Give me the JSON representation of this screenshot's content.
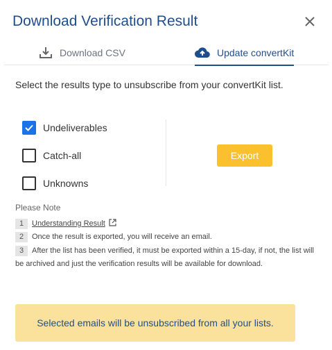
{
  "dialog": {
    "title": "Download Verification Result"
  },
  "tabs": [
    {
      "label": "Download CSV",
      "icon": "download-icon",
      "active": false
    },
    {
      "label": "Update convertKit",
      "icon": "cloud-upload-icon",
      "active": true
    }
  ],
  "instruction": "Select the results type to unsubscribe from your convertKit list.",
  "options": [
    {
      "label": "Undeliverables",
      "checked": true
    },
    {
      "label": "Catch-all",
      "checked": false
    },
    {
      "label": "Unknowns",
      "checked": false
    }
  ],
  "export_label": "Export",
  "note": {
    "title": "Please Note",
    "items": [
      {
        "num": "1",
        "text": "Understanding Result"
      },
      {
        "num": "2",
        "text": "Once the result is exported, you will receive an email."
      },
      {
        "num": "3",
        "text": "After the list has been verified, it must be exported within a 15-day, if not, the list will be archived and just the verification results will be available for download."
      }
    ]
  },
  "banner": "Selected emails will be unsubscribed from all your lists.",
  "colors": {
    "primary": "#1f4e8c",
    "checkbox": "#1a73e8",
    "export": "#fbc02d",
    "banner": "#fbe29c"
  }
}
